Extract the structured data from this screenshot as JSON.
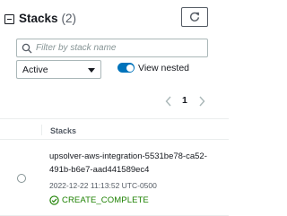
{
  "header": {
    "title": "Stacks",
    "count": "(2)"
  },
  "search": {
    "placeholder": "Filter by stack name",
    "value": ""
  },
  "filter": {
    "selected": "Active"
  },
  "toggle": {
    "label": "View nested",
    "on": true
  },
  "pagination": {
    "current_page": "1"
  },
  "table": {
    "column_header": "Stacks",
    "rows": [
      {
        "name": "upsolver-aws-integration-5531be78-ca52-491b-b6e7-aad441589ec4",
        "date": "2022-12-22 11:13:52 UTC-0500",
        "status": "CREATE_COMPLETE"
      }
    ]
  },
  "colors": {
    "accent": "#0073bb",
    "success": "#1d8102",
    "text": "#16191f",
    "muted": "#545b64"
  },
  "icons": {
    "collapse": "minus-square-icon",
    "refresh": "refresh-icon",
    "search": "search-icon",
    "dropdown": "caret-down-icon",
    "prev": "chevron-left-icon",
    "next": "chevron-right-icon",
    "status": "check-circle-icon"
  }
}
